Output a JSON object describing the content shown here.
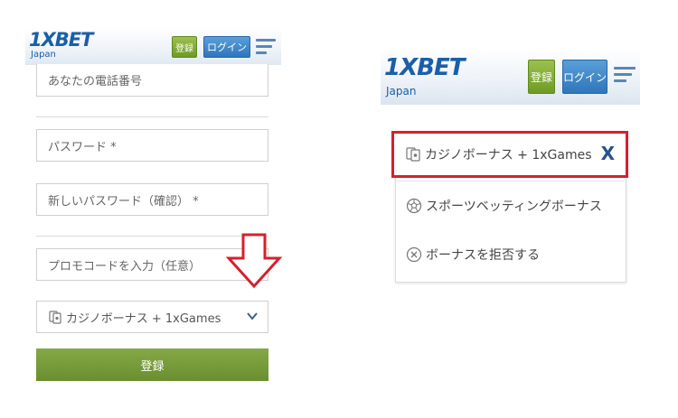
{
  "left": {
    "logo": "1XBET",
    "region": "Japan",
    "register_label": "登録",
    "login_label": "ログイン",
    "fields": [
      {
        "value": "あなたの電話番号"
      },
      {
        "value": "パスワード *"
      },
      {
        "value": "新しいパスワード（確認） *"
      },
      {
        "value": "プロモコードを入力（任意）"
      }
    ],
    "bonus_select": {
      "value": "カジノボーナス + 1xGames"
    },
    "submit_label": "登録"
  },
  "right": {
    "logo": "1XBET",
    "region": "Japan",
    "register_label": "登録",
    "login_label": "ログイン",
    "options": [
      {
        "label": "カジノボーナス + 1xGames",
        "icon": "casino-bonus-icon",
        "selected": true
      },
      {
        "label": "スポーツベッティングボーナス",
        "icon": "soccer-ball-icon",
        "selected": false
      },
      {
        "label": "ボーナスを拒否する",
        "icon": "decline-icon",
        "selected": false
      }
    ],
    "close_glyph": "X"
  },
  "colors": {
    "brand_blue": "#1a5fa8",
    "register_green": "#6e9b24",
    "login_blue": "#2f76bb",
    "highlight_red": "#d6202e",
    "arrow_red": "#d6202e"
  }
}
